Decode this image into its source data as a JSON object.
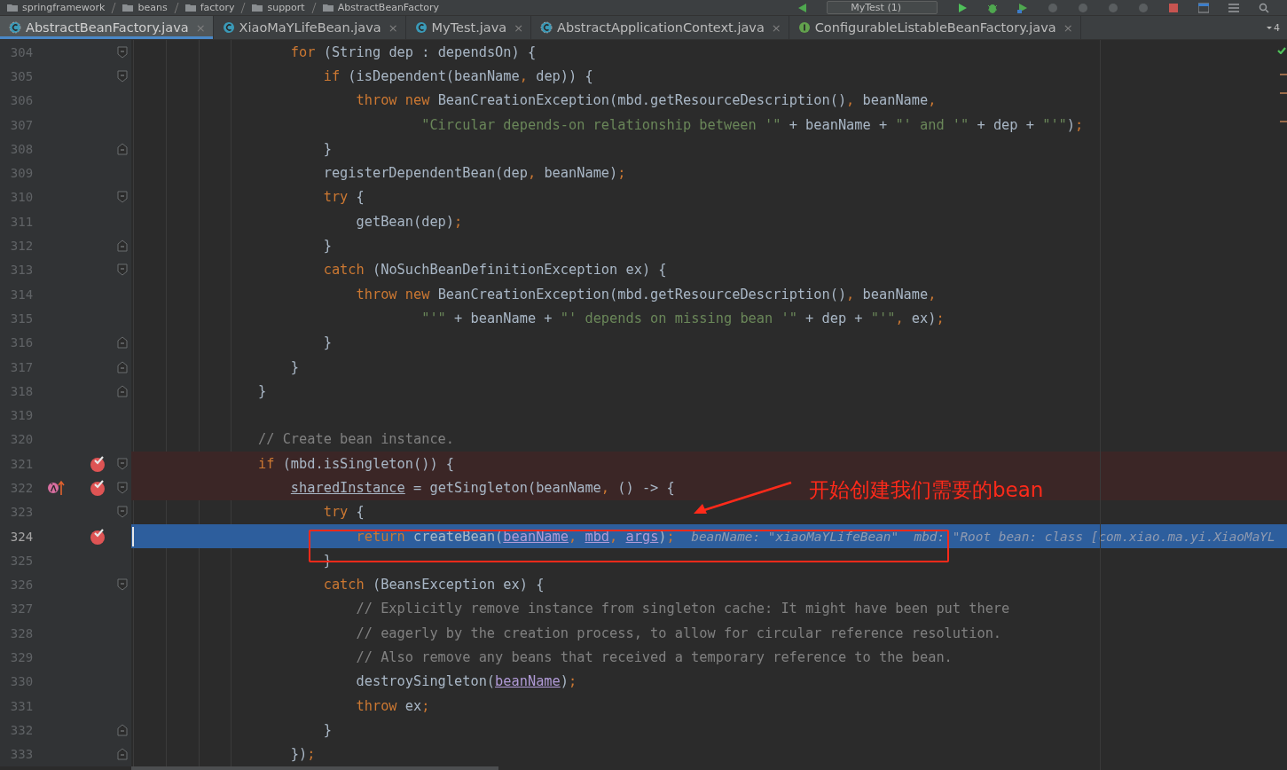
{
  "breadcrumbs": [
    "springframework",
    "beans",
    "factory",
    "support",
    "AbstractBeanFactory"
  ],
  "run_config": "MyTest (1)",
  "tabs": [
    {
      "label": "AbstractBeanFactory.java",
      "kind": "abstract",
      "selected": true,
      "close": "×"
    },
    {
      "label": "XiaoMaYLifeBean.java",
      "kind": "class",
      "selected": false,
      "close": "×"
    },
    {
      "label": "MyTest.java",
      "kind": "class",
      "selected": false,
      "close": "×"
    },
    {
      "label": "AbstractApplicationContext.java",
      "kind": "abstract",
      "selected": false,
      "close": "×"
    },
    {
      "label": "ConfigurableListableBeanFactory.java",
      "kind": "interface",
      "selected": false,
      "close": "×"
    }
  ],
  "tab_overflow": "4",
  "lines": [
    {
      "number": "304",
      "fold_start": true,
      "fold_end": false,
      "breakpoint": false,
      "current": false,
      "tokens": [
        {
          "kind": "kw",
          "text": "    for"
        },
        {
          "kind": "p",
          "text": " (String dep : dependsOn) {"
        }
      ]
    },
    {
      "number": "305",
      "fold_start": true,
      "fold_end": false,
      "breakpoint": false,
      "current": false,
      "tokens": [
        {
          "kind": "kw",
          "text": "        if"
        },
        {
          "kind": "p",
          "text": " (isDependent(beanName"
        },
        {
          "kind": "op",
          "text": ","
        },
        {
          "kind": "p",
          "text": " dep)) {"
        }
      ]
    },
    {
      "number": "306",
      "fold_start": false,
      "fold_end": false,
      "breakpoint": false,
      "current": false,
      "tokens": [
        {
          "kind": "kw",
          "text": "            throw new"
        },
        {
          "kind": "p",
          "text": " BeanCreationException(mbd.getResourceDescription()"
        },
        {
          "kind": "op",
          "text": ","
        },
        {
          "kind": "p",
          "text": " beanName"
        },
        {
          "kind": "op",
          "text": ","
        }
      ]
    },
    {
      "number": "307",
      "fold_start": false,
      "fold_end": false,
      "breakpoint": false,
      "current": false,
      "tokens": [
        {
          "kind": "str",
          "text": "                    \"Circular depends-on relationship between '\""
        },
        {
          "kind": "p",
          "text": " + beanName + "
        },
        {
          "kind": "str",
          "text": "\"' and '\""
        },
        {
          "kind": "p",
          "text": " + dep + "
        },
        {
          "kind": "str",
          "text": "\"'\""
        },
        {
          "kind": "p",
          "text": ")"
        },
        {
          "kind": "op",
          "text": ";"
        }
      ]
    },
    {
      "number": "308",
      "fold_start": false,
      "fold_end": true,
      "breakpoint": false,
      "current": false,
      "tokens": [
        {
          "kind": "p",
          "text": "        }"
        }
      ]
    },
    {
      "number": "309",
      "fold_start": false,
      "fold_end": false,
      "breakpoint": false,
      "current": false,
      "tokens": [
        {
          "kind": "p",
          "text": "        registerDependentBean(dep"
        },
        {
          "kind": "op",
          "text": ","
        },
        {
          "kind": "p",
          "text": " beanName)"
        },
        {
          "kind": "op",
          "text": ";"
        }
      ]
    },
    {
      "number": "310",
      "fold_start": true,
      "fold_end": false,
      "breakpoint": false,
      "current": false,
      "tokens": [
        {
          "kind": "kw",
          "text": "        try"
        },
        {
          "kind": "p",
          "text": " {"
        }
      ]
    },
    {
      "number": "311",
      "fold_start": false,
      "fold_end": false,
      "breakpoint": false,
      "current": false,
      "tokens": [
        {
          "kind": "p",
          "text": "            getBean(dep)"
        },
        {
          "kind": "op",
          "text": ";"
        }
      ]
    },
    {
      "number": "312",
      "fold_start": false,
      "fold_end": true,
      "breakpoint": false,
      "current": false,
      "tokens": [
        {
          "kind": "p",
          "text": "        }"
        }
      ]
    },
    {
      "number": "313",
      "fold_start": true,
      "fold_end": false,
      "breakpoint": false,
      "current": false,
      "tokens": [
        {
          "kind": "kw",
          "text": "        catch"
        },
        {
          "kind": "p",
          "text": " (NoSuchBeanDefinitionException ex) {"
        }
      ]
    },
    {
      "number": "314",
      "fold_start": false,
      "fold_end": false,
      "breakpoint": false,
      "current": false,
      "tokens": [
        {
          "kind": "kw",
          "text": "            throw new"
        },
        {
          "kind": "p",
          "text": " BeanCreationException(mbd.getResourceDescription()"
        },
        {
          "kind": "op",
          "text": ","
        },
        {
          "kind": "p",
          "text": " beanName"
        },
        {
          "kind": "op",
          "text": ","
        }
      ]
    },
    {
      "number": "315",
      "fold_start": false,
      "fold_end": false,
      "breakpoint": false,
      "current": false,
      "tokens": [
        {
          "kind": "str",
          "text": "                    \"'\""
        },
        {
          "kind": "p",
          "text": " + beanName + "
        },
        {
          "kind": "str",
          "text": "\"' depends on missing bean '\""
        },
        {
          "kind": "p",
          "text": " + dep + "
        },
        {
          "kind": "str",
          "text": "\"'\""
        },
        {
          "kind": "op",
          "text": ","
        },
        {
          "kind": "p",
          "text": " ex)"
        },
        {
          "kind": "op",
          "text": ";"
        }
      ]
    },
    {
      "number": "316",
      "fold_start": false,
      "fold_end": true,
      "breakpoint": false,
      "current": false,
      "tokens": [
        {
          "kind": "p",
          "text": "        }"
        }
      ]
    },
    {
      "number": "317",
      "fold_start": false,
      "fold_end": true,
      "breakpoint": false,
      "current": false,
      "tokens": [
        {
          "kind": "p",
          "text": "    }"
        }
      ]
    },
    {
      "number": "318",
      "fold_start": false,
      "fold_end": true,
      "breakpoint": false,
      "current": false,
      "tokens": [
        {
          "kind": "p",
          "text": "}"
        }
      ]
    },
    {
      "number": "319",
      "fold_start": false,
      "fold_end": false,
      "breakpoint": false,
      "current": false
    },
    {
      "number": "320",
      "fold_start": false,
      "fold_end": false,
      "breakpoint": false,
      "current": false,
      "tokens": [
        {
          "kind": "cmt",
          "text": "// Create bean instance."
        }
      ]
    },
    {
      "number": "321",
      "fold_start": true,
      "fold_end": false,
      "breakpoint": true,
      "current": false,
      "tokens": [
        {
          "kind": "kw",
          "text": "if"
        },
        {
          "kind": "p",
          "text": " (mbd.isSingleton()) {"
        }
      ]
    },
    {
      "number": "322",
      "fold_start": true,
      "fold_end": false,
      "breakpoint": true,
      "current": false,
      "lambda": true,
      "tokens": [
        {
          "kind": "fld",
          "text": "    sharedInstance"
        },
        {
          "kind": "p",
          "text": " = getSingleton(beanName"
        },
        {
          "kind": "op",
          "text": ","
        },
        {
          "kind": "p",
          "text": " () -> {"
        }
      ]
    },
    {
      "number": "323",
      "fold_start": true,
      "fold_end": false,
      "breakpoint": false,
      "current": false,
      "tokens": [
        {
          "kind": "kw",
          "text": "        try"
        },
        {
          "kind": "p",
          "text": " {"
        }
      ]
    },
    {
      "number": "324",
      "fold_start": false,
      "fold_end": false,
      "breakpoint": true,
      "current": true,
      "tokens": [
        {
          "kind": "kw",
          "text": "            return"
        },
        {
          "kind": "p",
          "text": " createBean("
        },
        {
          "kind": "par",
          "text": "beanName"
        },
        {
          "kind": "op",
          "text": ","
        },
        {
          "kind": "par",
          "text": " mbd"
        },
        {
          "kind": "op",
          "text": ","
        },
        {
          "kind": "par",
          "text": " args"
        },
        {
          "kind": "p",
          "text": ")"
        },
        {
          "kind": "op",
          "text": ";"
        },
        {
          "kind": "hint",
          "text": "  beanName: \"xiaoMaYLifeBean\"  mbd: \"Root bean: class [com.xiao.ma.yi.XiaoMaYL"
        }
      ]
    },
    {
      "number": "325",
      "fold_start": false,
      "fold_end": false,
      "breakpoint": false,
      "current": false,
      "tokens": [
        {
          "kind": "p",
          "text": "        }"
        }
      ]
    },
    {
      "number": "326",
      "fold_start": true,
      "fold_end": false,
      "breakpoint": false,
      "current": false,
      "tokens": [
        {
          "kind": "kw",
          "text": "        catch"
        },
        {
          "kind": "p",
          "text": " (BeansException ex) {"
        }
      ]
    },
    {
      "number": "327",
      "fold_start": false,
      "fold_end": false,
      "breakpoint": false,
      "current": false,
      "tokens": [
        {
          "kind": "cmt",
          "text": "            // Explicitly remove instance from singleton cache: It might have been put there"
        }
      ]
    },
    {
      "number": "328",
      "fold_start": false,
      "fold_end": false,
      "breakpoint": false,
      "current": false,
      "tokens": [
        {
          "kind": "cmt",
          "text": "            // eagerly by the creation process, to allow for circular reference resolution."
        }
      ]
    },
    {
      "number": "329",
      "fold_start": false,
      "fold_end": false,
      "breakpoint": false,
      "current": false,
      "tokens": [
        {
          "kind": "cmt",
          "text": "            // Also remove any beans that received a temporary reference to the bean."
        }
      ]
    },
    {
      "number": "330",
      "fold_start": false,
      "fold_end": false,
      "breakpoint": false,
      "current": false,
      "tokens": [
        {
          "kind": "p",
          "text": "            destroySingleton("
        },
        {
          "kind": "par",
          "text": "beanName"
        },
        {
          "kind": "p",
          "text": ")"
        },
        {
          "kind": "op",
          "text": ";"
        }
      ]
    },
    {
      "number": "331",
      "fold_start": false,
      "fold_end": false,
      "breakpoint": false,
      "current": false,
      "tokens": [
        {
          "kind": "kw",
          "text": "            throw"
        },
        {
          "kind": "p",
          "text": " ex"
        },
        {
          "kind": "op",
          "text": ";"
        }
      ]
    },
    {
      "number": "332",
      "fold_start": false,
      "fold_end": true,
      "breakpoint": false,
      "current": false,
      "tokens": [
        {
          "kind": "p",
          "text": "        }"
        }
      ]
    },
    {
      "number": "333",
      "fold_start": false,
      "fold_end": true,
      "breakpoint": false,
      "current": false,
      "tokens": [
        {
          "kind": "p",
          "text": "    })"
        },
        {
          "kind": "op",
          "text": ";"
        }
      ]
    }
  ],
  "annotation": {
    "text": "开始创建我们需要的bean"
  }
}
